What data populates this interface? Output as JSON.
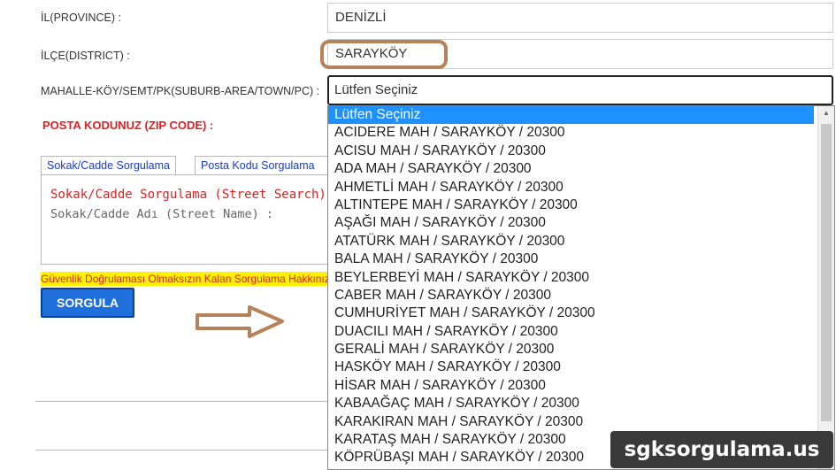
{
  "form": {
    "province_label": "İL(PROVINCE) :",
    "province_value": "DENİZLİ",
    "district_label": "İLÇE(DISTRICT) :",
    "district_value": "SARAYKÖY",
    "suburb_label": "MAHALLE-KÖY/SEMT/PK(SUBURB-AREA/TOWN/PC) :",
    "suburb_value": "Lütfen Seçiniz",
    "zip_label": "POSTA KODUNUZ (ZIP CODE) :"
  },
  "tabs": [
    {
      "label": "Sokak/Cadde Sorgulama"
    },
    {
      "label": "Posta Kodu Sorgulama"
    }
  ],
  "panel": {
    "title": "Sokak/Cadde Sorgulama (Street Search)",
    "field_label": "Sokak/Cadde Adı (Street Name) :"
  },
  "warning": "Güvenlik Doğrulaması Olmaksızın Kalan Sorgulama Hakkınız",
  "query_button": "SORGULA",
  "dropdown": {
    "options": [
      "Lütfen Seçiniz",
      "ACIDERE MAH / SARAYKÖY / 20300",
      "ACISU MAH / SARAYKÖY / 20300",
      "ADA MAH / SARAYKÖY / 20300",
      "AHMETLİ MAH / SARAYKÖY / 20300",
      "ALTINTEPE MAH / SARAYKÖY / 20300",
      "AŞAĞI MAH / SARAYKÖY / 20300",
      "ATATÜRK MAH / SARAYKÖY / 20300",
      "BALA MAH / SARAYKÖY / 20300",
      "BEYLERBEYİ MAH / SARAYKÖY / 20300",
      "CABER MAH / SARAYKÖY / 20300",
      "CUMHURİYET MAH / SARAYKÖY / 20300",
      "DUACILI MAH / SARAYKÖY / 20300",
      "GERALİ MAH / SARAYKÖY / 20300",
      "HASKÖY MAH / SARAYKÖY / 20300",
      "HİSAR MAH / SARAYKÖY / 20300",
      "KABAAĞAÇ MAH / SARAYKÖY / 20300",
      "KARAKIRAN MAH / SARAYKÖY / 20300",
      "KARATAŞ MAH / SARAYKÖY / 20300",
      "KÖPRÜBAŞI MAH / SARAYKÖY / 20300"
    ]
  },
  "watermark": "sgksorgulama.us",
  "colors": {
    "highlight_ring": "#b5825a",
    "selected_option": "#1e90ff",
    "button": "#1f6fdc",
    "warning_bg": "#fff200",
    "label_red": "#e02020"
  }
}
